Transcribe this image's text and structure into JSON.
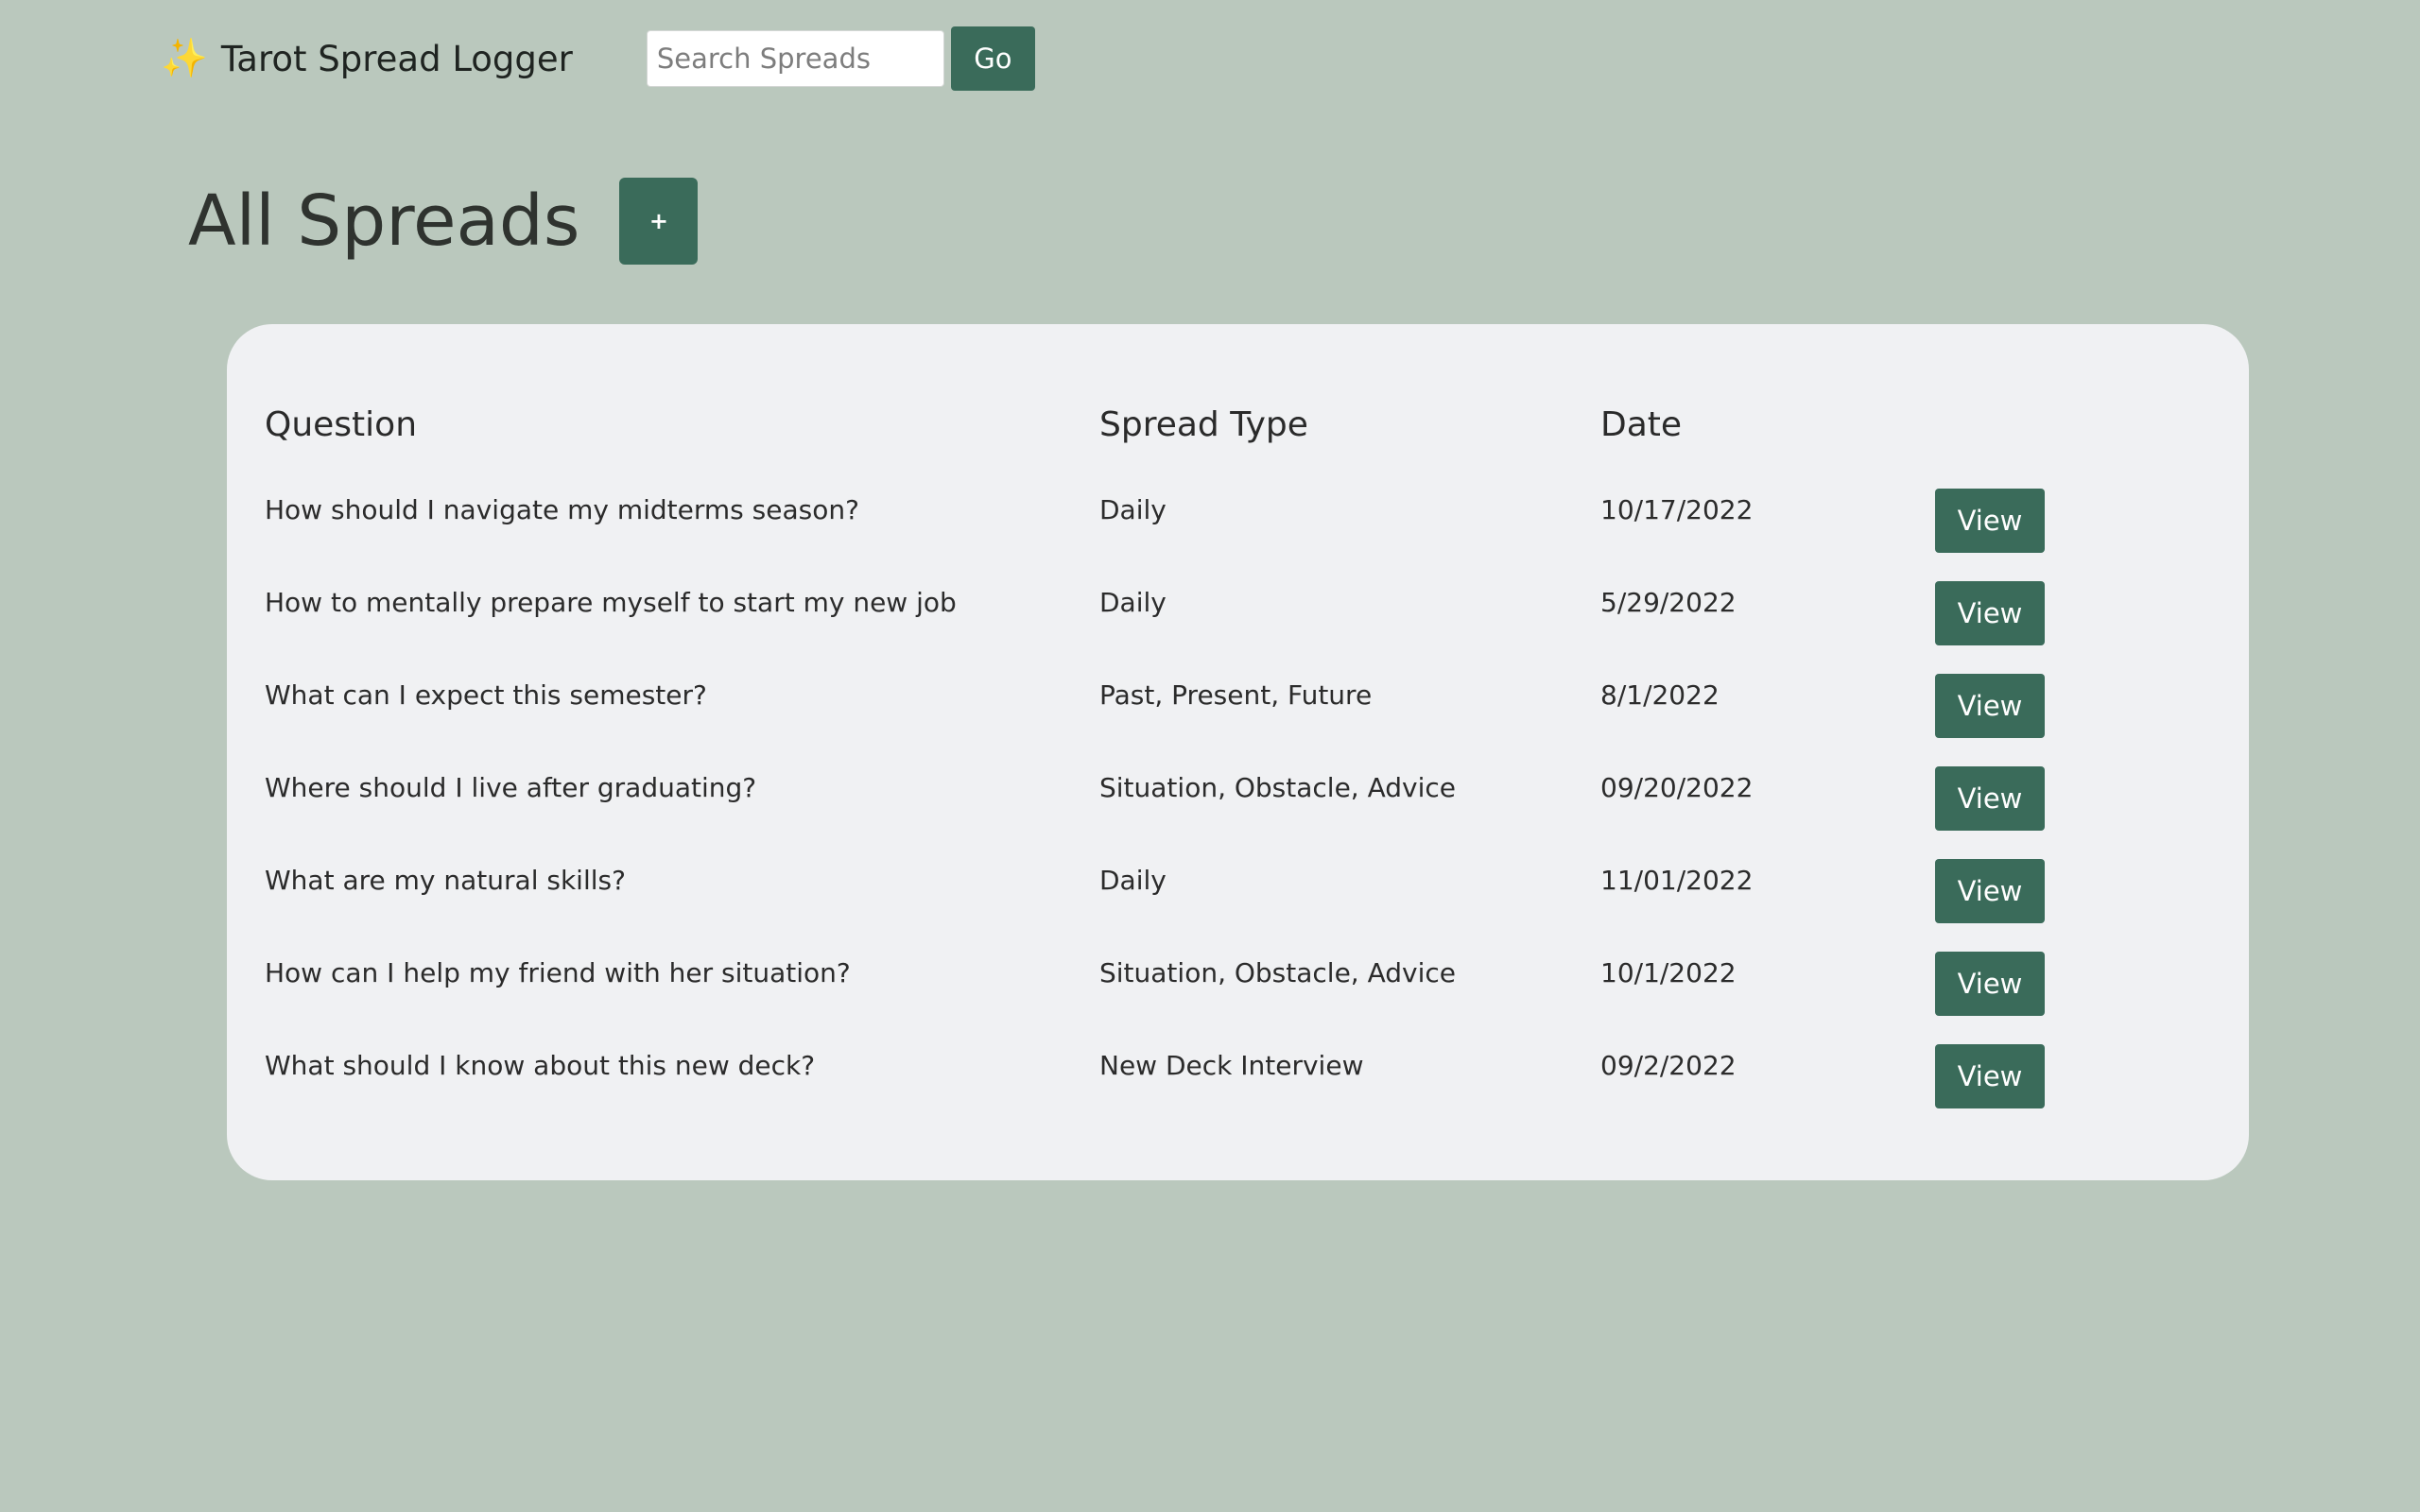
{
  "nav": {
    "brand_icon": "sparkles-icon",
    "brand_emoji": "✨",
    "brand": "Tarot Spread Logger",
    "search_placeholder": "Search Spreads",
    "go_label": "Go"
  },
  "page": {
    "title": "All Spreads",
    "add_label": "+"
  },
  "colors": {
    "background": "#bac8bd",
    "card": "#f0f1f3",
    "button": "#3a6b5a",
    "sparkle": "#f2c230"
  },
  "table": {
    "headers": {
      "question": "Question",
      "spread_type": "Spread Type",
      "date": "Date"
    },
    "view_label": "View",
    "rows": [
      {
        "question": "How should I navigate my midterms season?",
        "spread_type": "Daily",
        "date": "10/17/2022"
      },
      {
        "question": "How to mentally prepare myself to start my new job",
        "spread_type": "Daily",
        "date": "5/29/2022"
      },
      {
        "question": "What can I expect this semester?",
        "spread_type": "Past, Present, Future",
        "date": "8/1/2022"
      },
      {
        "question": "Where should I live after graduating?",
        "spread_type": "Situation, Obstacle, Advice",
        "date": "09/20/2022"
      },
      {
        "question": "What are my natural skills?",
        "spread_type": "Daily",
        "date": "11/01/2022"
      },
      {
        "question": "How can I help my friend with her situation?",
        "spread_type": "Situation, Obstacle, Advice",
        "date": "10/1/2022"
      },
      {
        "question": "What should I know about this new deck?",
        "spread_type": "New Deck Interview",
        "date": "09/2/2022"
      }
    ]
  }
}
